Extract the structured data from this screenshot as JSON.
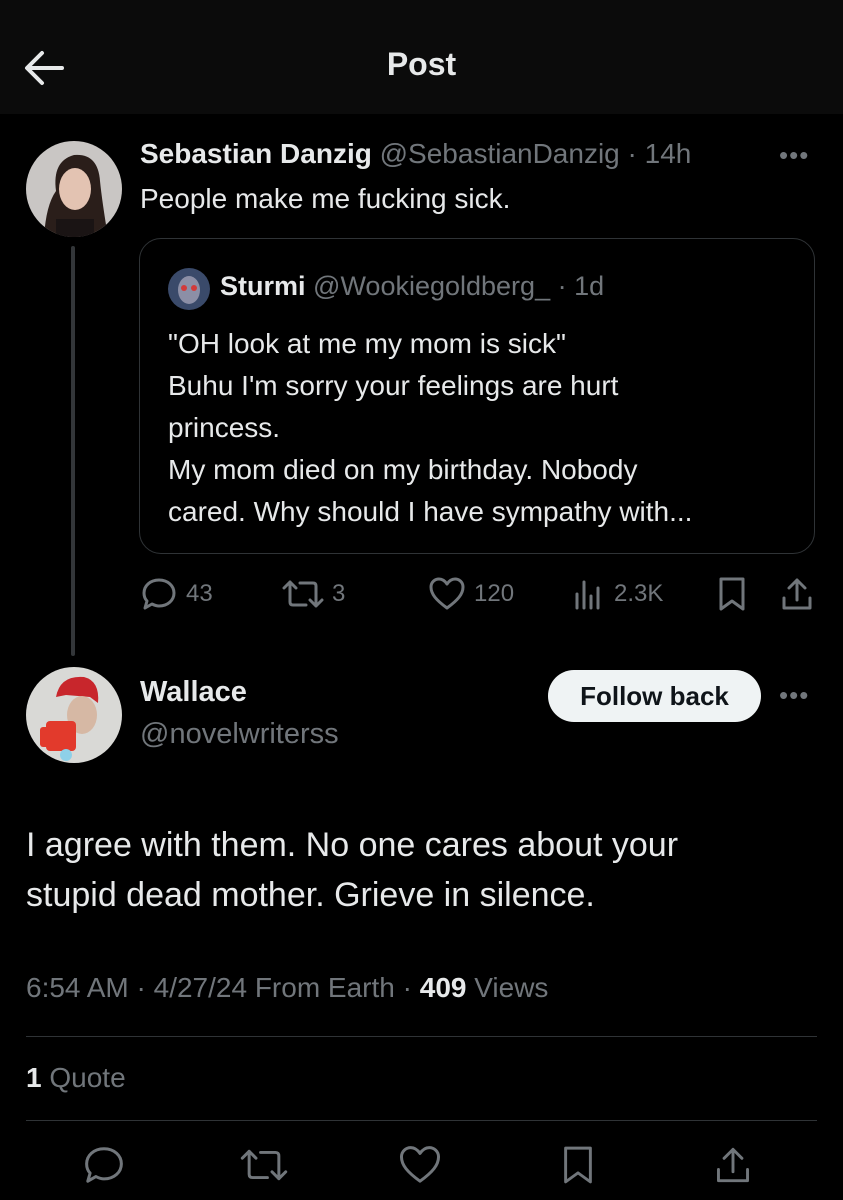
{
  "header": {
    "title": "Post"
  },
  "main_post": {
    "author_name": "Sebastian Danzig",
    "handle": "@SebastianDanzig",
    "time": "· 14h",
    "text": "People make me fucking sick.",
    "quote": {
      "author_name": "Sturmi",
      "handle": "@Wookiegoldberg_",
      "time": "· 1d",
      "lines": [
        "\"OH look at me my mom is sick\"",
        "Buhu I'm sorry your feelings are hurt",
        "princess.",
        "My mom died on my birthday. Nobody",
        "cared. Why should I have sympathy with..."
      ]
    },
    "stats": {
      "replies": "43",
      "reposts": "3",
      "likes": "120",
      "views": "2.3K"
    }
  },
  "reply": {
    "author_name": "Wallace",
    "handle": "@novelwriterss",
    "follow_label": "Follow back",
    "text_lines": [
      "I agree with them. No one cares about your",
      "stupid dead mother. Grieve in silence."
    ],
    "meta": {
      "time": "6:54 AM",
      "date": "4/27/24",
      "source": "From Earth",
      "views_count": "409",
      "views_label": "Views"
    },
    "quotes_count": "1",
    "quotes_label": "Quote"
  },
  "colors": {
    "background": "#000000",
    "text": "#e7e9ea",
    "muted": "#71767b",
    "divider": "#2f3336"
  }
}
